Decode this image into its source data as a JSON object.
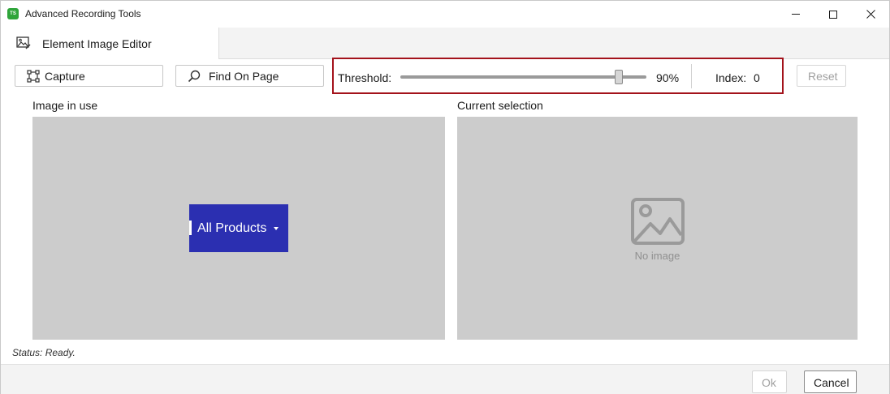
{
  "window": {
    "title": "Advanced Recording Tools",
    "logo_text": "TS",
    "logo_color": "#2fa53a"
  },
  "tabs": [
    {
      "label": "Element Image Editor",
      "icon": "image-edit-icon"
    }
  ],
  "toolbar": {
    "capture_label": "Capture",
    "capture_icon": "capture-frame-icon",
    "find_label": "Find On Page",
    "find_icon": "search-icon",
    "threshold_label": "Threshold:",
    "threshold_value": "90%",
    "threshold_level": 0.9,
    "index_label": "Index:",
    "index_value": "0",
    "reset_label": "Reset",
    "highlight_color": "#a3121b"
  },
  "panels": {
    "image_in_use_title": "Image in use",
    "current_selection_title": "Current selection",
    "captured_image_text": "All Products",
    "captured_image_color": "#2b2fb1",
    "no_image_text": "No image",
    "no_image_icon": "image-placeholder-icon"
  },
  "status": "Status: Ready.",
  "footer": {
    "ok_label": "Ok",
    "cancel_label": "Cancel"
  }
}
